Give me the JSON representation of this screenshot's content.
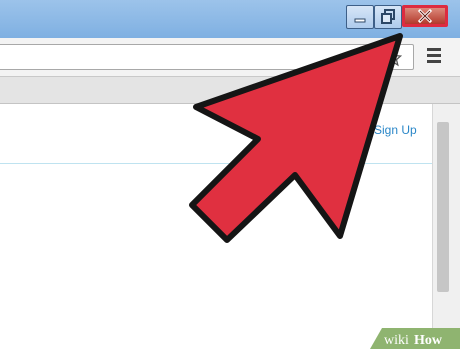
{
  "window": {
    "buttons": {
      "minimize_icon": "minimize-icon",
      "restore_icon": "restore-icon",
      "close_icon": "close-icon"
    },
    "highlight_color": "#dd2b40"
  },
  "toolbar": {
    "star_icon": "star-icon",
    "menu_icon": "hamburger-menu-icon"
  },
  "page": {
    "signup_label": "Sign Up",
    "link_color": "#2a87c8"
  },
  "overlay": {
    "arrow_color": "#e03040",
    "arrow_icon": "pointer-arrow"
  },
  "watermark": {
    "logo_text": "wikiHow"
  }
}
